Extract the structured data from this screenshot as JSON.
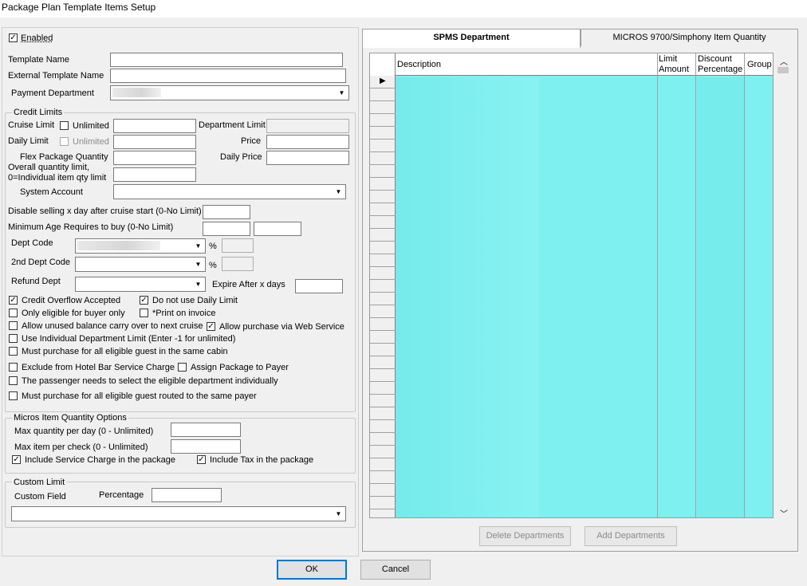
{
  "window": {
    "title": "Package Plan Template Items Setup"
  },
  "left": {
    "enabled_label": "Enabled",
    "template_name_label": "Template Name",
    "external_template_name_label": "External Template Name",
    "payment_department_label": "Payment Department",
    "credit_limits": {
      "title": "Credit Limits",
      "cruise_limit_label": "Cruise Limit",
      "unlimited_label": "Unlimited",
      "department_limit_label": "Department Limit",
      "daily_limit_label": "Daily Limit",
      "unlimited2_label": "Unlimited",
      "price_label": "Price",
      "flex_package_quantity_label": "Flex Package Quantity",
      "daily_price_label": "Daily Price",
      "overall_qty_line1": "Overall quantity limit,",
      "overall_qty_line2": "0=Individual item qty limit",
      "system_account_label": "System Account",
      "disable_selling_label": "Disable selling x day after cruise start (0-No Limit)",
      "min_age_label": "Minimum Age Requires to buy (0-No Limit)",
      "dept_code_label": "Dept Code",
      "percent1": "%",
      "second_dept_code_label": "2nd Dept Code",
      "percent2": "%",
      "refund_dept_label": "Refund Dept",
      "expire_after_label": "Expire After x days",
      "checks": {
        "credit_overflow": "Credit Overflow Accepted",
        "no_daily_limit": "Do not use Daily Limit",
        "only_eligible_buyer": "Only eligible for buyer only",
        "print_on_invoice": "*Print on invoice",
        "allow_unused_balance": "Allow unused balance carry over to next cruise",
        "allow_purchase_web": "Allow purchase via Web Service",
        "use_individual_dept_limit": "Use Individual Department Limit (Enter -1 for unlimited)",
        "must_purchase_same_cabin": "Must purchase for all eligible guest in the same cabin",
        "exclude_hotel_bar": "Exclude from Hotel Bar Service Charge",
        "assign_package_payer": "Assign Package to Payer",
        "passenger_select_dept": "The passenger needs to select the eligible department individually",
        "must_purchase_same_payer": "Must purchase for all eligible guest routed to the same payer"
      }
    },
    "micros": {
      "title": "Micros Item Quantity Options",
      "max_qty_day_label": "Max quantity per day (0 - Unlimited)",
      "max_item_check_label": "Max item per check (0 - Unlimited)",
      "include_service_charge": "Include Service Charge in the package",
      "include_tax": "Include Tax in the package"
    },
    "custom_limit": {
      "title": "Custom Limit",
      "custom_field_label": "Custom Field",
      "percentage_label": "Percentage"
    }
  },
  "right": {
    "tabs": [
      {
        "label": "SPMS Department"
      },
      {
        "label": "MICROS 9700/Simphony Item Quantity"
      }
    ],
    "grid": {
      "columns": {
        "description": "Description",
        "limit_amount_line1": "Limit",
        "limit_amount_line2": "Amount",
        "discount_line1": "Discount",
        "discount_line2": "Percentage",
        "group": "Group"
      }
    },
    "delete_departments": "Delete Departments",
    "add_departments": "Add Departments"
  },
  "footer": {
    "ok": "OK",
    "cancel": "Cancel"
  },
  "colors": {
    "grid_fill": "#7ff0f0",
    "accent": "#0078d7"
  }
}
